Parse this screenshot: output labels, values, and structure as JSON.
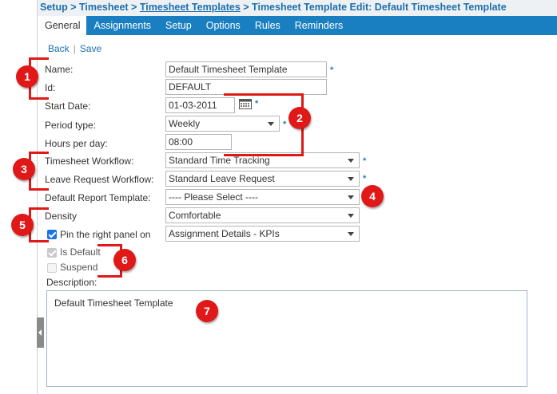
{
  "breadcrumb": {
    "part1": "Setup > Timesheet > ",
    "link": "Timesheet Templates",
    "part2": " > Timesheet Template Edit: Default Timesheet Template"
  },
  "tabs": [
    {
      "label": "General",
      "active": true
    },
    {
      "label": "Assignments"
    },
    {
      "label": "Setup"
    },
    {
      "label": "Options"
    },
    {
      "label": "Rules"
    },
    {
      "label": "Reminders"
    }
  ],
  "actions": {
    "back": "Back",
    "separator": "|",
    "save": "Save"
  },
  "form": {
    "name": {
      "label": "Name:",
      "value": "Default Timesheet Template",
      "required": "*"
    },
    "id": {
      "label": "Id:",
      "value": "DEFAULT"
    },
    "start_date": {
      "label": "Start Date:",
      "value": "01-03-2011",
      "required": "*"
    },
    "period_type": {
      "label": "Period type:",
      "value": "Weekly",
      "required": "*"
    },
    "hours_per_day": {
      "label": "Hours per day:",
      "value": "08:00"
    },
    "timesheet_workflow": {
      "label": "Timesheet Workflow:",
      "value": "Standard Time Tracking",
      "required": "*"
    },
    "leave_request_workflow": {
      "label": "Leave Request Workflow:",
      "value": "Standard Leave Request",
      "required": "*"
    },
    "default_report_template": {
      "label": "Default Report Template:",
      "value": "---- Please Select ----"
    },
    "density": {
      "label": "Density",
      "value": "Comfortable"
    },
    "pin_right_panel": {
      "label": "Pin the right panel on",
      "checked": true,
      "value": "Assignment Details - KPIs"
    },
    "is_default": {
      "label": "Is Default",
      "checked": true,
      "disabled": true
    },
    "suspend": {
      "label": "Suspend",
      "checked": false,
      "disabled": true
    },
    "description": {
      "label": "Description:",
      "value": "Default Timesheet Template"
    }
  },
  "callouts": [
    "1",
    "2",
    "3",
    "4",
    "5",
    "6",
    "7"
  ],
  "colors": {
    "accent": "#1a7fc1",
    "callout": "#e01818",
    "breadcrumb_bg": "#eef1f4"
  },
  "icons": [
    "calendar-icon",
    "chevron-down-icon",
    "collapse-arrow-icon"
  ]
}
